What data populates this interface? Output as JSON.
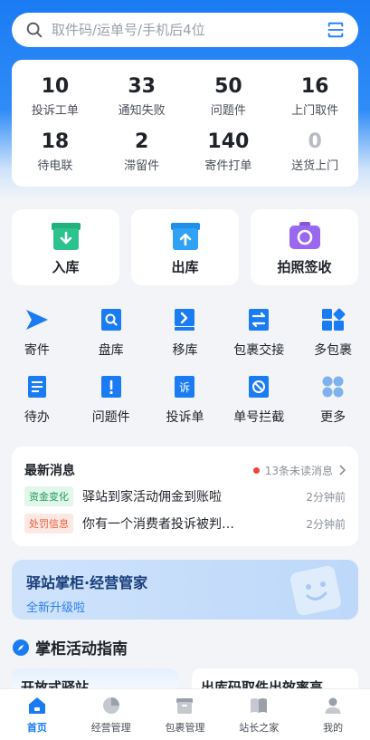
{
  "search": {
    "placeholder": "取件码/运单号/手机后4位"
  },
  "stats": [
    {
      "num": "10",
      "label": "投诉工单"
    },
    {
      "num": "33",
      "label": "通知失败"
    },
    {
      "num": "50",
      "label": "问题件"
    },
    {
      "num": "16",
      "label": "上门取件"
    },
    {
      "num": "18",
      "label": "待电联"
    },
    {
      "num": "2",
      "label": "滞留件"
    },
    {
      "num": "140",
      "label": "寄件打单"
    },
    {
      "num": "0",
      "label": "送货上门"
    }
  ],
  "big_actions": [
    {
      "label": "入库",
      "icon": "inbound-box-icon"
    },
    {
      "label": "出库",
      "icon": "outbound-box-icon"
    },
    {
      "label": "拍照签收",
      "icon": "camera-icon"
    }
  ],
  "grid": [
    {
      "label": "寄件",
      "icon": "send-icon"
    },
    {
      "label": "盘库",
      "icon": "inventory-icon"
    },
    {
      "label": "移库",
      "icon": "move-icon"
    },
    {
      "label": "包裹交接",
      "icon": "handover-icon"
    },
    {
      "label": "多包裹",
      "icon": "multi-package-icon"
    },
    {
      "label": "待办",
      "icon": "todo-icon"
    },
    {
      "label": "问题件",
      "icon": "problem-icon"
    },
    {
      "label": "投诉单",
      "icon": "complaint-icon"
    },
    {
      "label": "单号拦截",
      "icon": "intercept-icon"
    },
    {
      "label": "更多",
      "icon": "more-icon"
    }
  ],
  "messages": {
    "title": "最新消息",
    "unread": "13条未读消息",
    "items": [
      {
        "tag": "资金变化",
        "text": "驿站到家活动佣金到账啦",
        "time": "2分钟前"
      },
      {
        "tag": "处罚信息",
        "text": "你有一个消费者投诉被判…",
        "time": "2分钟前"
      }
    ]
  },
  "banner": {
    "title": "驿站掌柜·经营管家",
    "subtitle": "全新升级啦"
  },
  "guide": {
    "title": "掌柜活动指南",
    "cards": [
      "开放式驿站",
      "出库码取件出效率高"
    ]
  },
  "tabs": [
    {
      "label": "首页",
      "icon": "home-icon",
      "active": true
    },
    {
      "label": "经营管理",
      "icon": "pie-chart-icon",
      "active": false
    },
    {
      "label": "包裹管理",
      "icon": "package-icon",
      "active": false
    },
    {
      "label": "站长之家",
      "icon": "book-icon",
      "active": false
    },
    {
      "label": "我的",
      "icon": "user-icon",
      "active": false
    }
  ],
  "colors": {
    "primary": "#1b7bf3",
    "green_icon": "#2bc28e",
    "blue_icon": "#2fa2f5",
    "purple_icon": "#9a68ee"
  }
}
